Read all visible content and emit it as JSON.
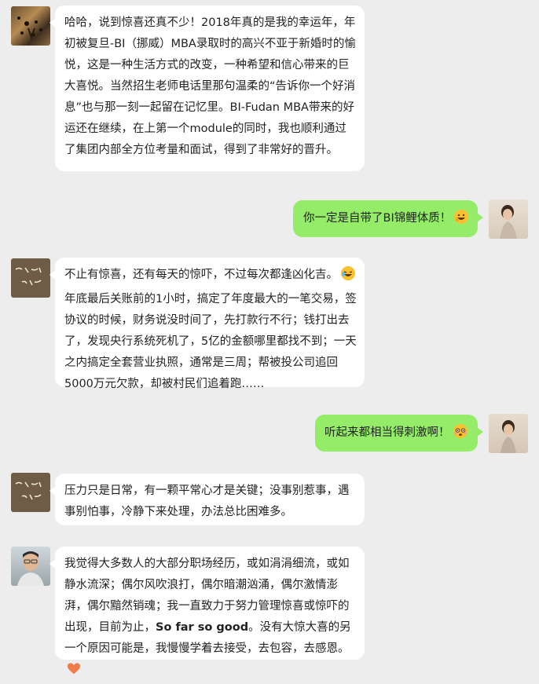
{
  "messages": [
    {
      "side": "left",
      "avatar": "cheetah-avatar",
      "text": "哈哈，说到惊喜还真不少！2018年真的是我的幸运年，年初被复旦-BI（挪威）MBA录取时的高兴不亚于新婚时的愉悦，这是一种生活方式的改变，一种希望和信心带来的巨大喜悦。当然招生老师电话里那句温柔的“告诉你一个好消息”也与那一刻一起留在记忆里。BI-Fudan MBA带来的好运还在继续，在上第一个module的同时，我也顺利通过了集团内部全方位考量和面试，得到了非常好的晋升。"
    },
    {
      "side": "right",
      "avatar": "woman-avatar",
      "text": "你一定是自带了BI锦鲤体质！",
      "emoji": "grinning-face-icon"
    },
    {
      "side": "left",
      "avatar": "calligraphy-avatar",
      "avatar_text": "物我",
      "text_first": "不止有惊喜，还有每天的惊吓，不过每次都逢凶化吉。",
      "emoji_inline": "laughing-face-icon",
      "text": "年底最后关账前的1小时，搞定了年度最大的一笔交易，签协议的时候，财务说没时间了，先打款行不行；钱打出去了，发现央行系统死机了，5亿的金额哪里都找不到；一天之内搞定全套营业执照，通常是三周；帮被投公司追回5000万元欠款，却被村民们追着跑……"
    },
    {
      "side": "right",
      "avatar": "woman-avatar",
      "text": "听起来都相当得刺激啊！",
      "emoji": "flushed-face-icon"
    },
    {
      "side": "left",
      "avatar": "calligraphy-avatar",
      "avatar_text": "物我",
      "text": "压力只是日常，有一颗平常心才是关键；没事别惹事，遇事别怕事，冷静下来处理，办法总比困难多。"
    },
    {
      "side": "left",
      "avatar": "man-avatar",
      "text_a": "我觉得大多数人的大部分职场经历，或如涓涓细流，或如静水流深；偶尔风吹浪打，偶尔暗潮汹涌，偶尔激情澎湃，偶尔黯然销魂；我一直致力于努力管理惊喜或惊吓的出现，目前为止，",
      "text_bold": "So far so good",
      "text_b": "。没有大惊大喜的另一个原因可能是，我慢慢学着去接受，去包容，去感恩。",
      "emoji": "heart-icon"
    }
  ],
  "colors": {
    "background": "#ededed",
    "left_bubble": "#ffffff",
    "right_bubble": "#95ec69"
  }
}
